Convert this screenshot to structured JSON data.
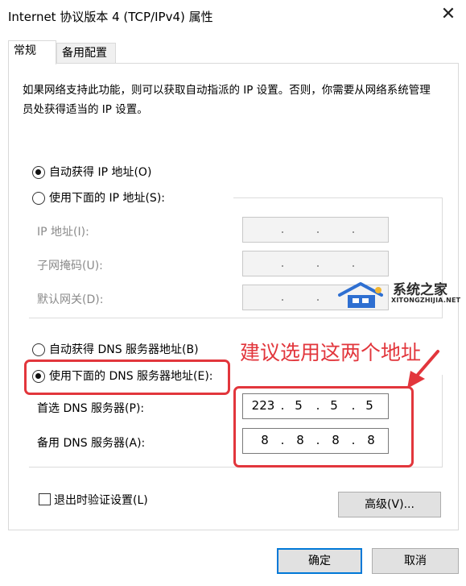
{
  "window": {
    "title": "Internet 协议版本 4 (TCP/IPv4) 属性",
    "close_glyph": "✕"
  },
  "tabs": [
    {
      "label": "常规"
    },
    {
      "label": "备用配置"
    }
  ],
  "description": "如果网络支持此功能，则可以获取自动指派的 IP 设置。否则，你需要从网络系统管理员处获得适当的 IP 设置。",
  "ip_section": {
    "auto_label": "自动获得 IP 地址(O)",
    "manual_label": "使用下面的 IP 地址(S):",
    "auto_selected": true,
    "fields": [
      {
        "label": "IP 地址(I):",
        "octets": [
          "",
          "",
          "",
          ""
        ]
      },
      {
        "label": "子网掩码(U):",
        "octets": [
          "",
          "",
          "",
          ""
        ]
      },
      {
        "label": "默认网关(D):",
        "octets": [
          "",
          "",
          "",
          ""
        ]
      }
    ]
  },
  "dns_section": {
    "auto_label": "自动获得 DNS 服务器地址(B)",
    "manual_label": "使用下面的 DNS 服务器地址(E):",
    "manual_selected": true,
    "preferred": {
      "label": "首选 DNS 服务器(P):",
      "octets": [
        "223",
        "5",
        "5",
        "5"
      ]
    },
    "alternate": {
      "label": "备用 DNS 服务器(A):",
      "octets": [
        "8",
        "8",
        "8",
        "8"
      ]
    }
  },
  "validate_on_exit": {
    "label": "退出时验证设置(L)",
    "checked": false
  },
  "buttons": {
    "advanced": "高级(V)...",
    "ok": "确定",
    "cancel": "取消"
  },
  "annotation": {
    "text": "建议选用这两个地址",
    "color": "#e2363c"
  },
  "watermark": {
    "name": "系统之家",
    "domain": "XITONGZHIJIA.NET"
  },
  "colors": {
    "accent": "#0078d7",
    "highlight_red": "#e2363c"
  }
}
